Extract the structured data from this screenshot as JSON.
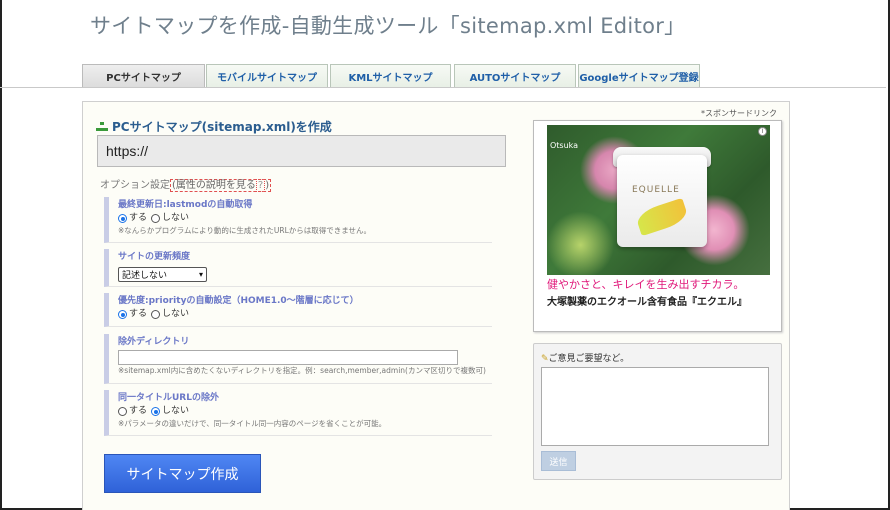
{
  "site_title": "サイトマップを作成-自動生成ツール「sitemap.xml Editor」",
  "tabs": [
    {
      "label": "PCサイトマップ"
    },
    {
      "label": "モバイルサイトマップ"
    },
    {
      "label": "KMLサイトマップ"
    },
    {
      "label": "AUTOサイトマップ"
    },
    {
      "label": "Googleサイトマップ登録"
    }
  ],
  "active_tab": "PCサイトマップ",
  "form": {
    "title": "PCサイトマップ(sitemap.xml)を作成",
    "url_value": "https://",
    "option_prefix": "オプション設定",
    "attr_link": "属性の説明を見る",
    "help_mark": "?"
  },
  "options": [
    {
      "title": "最終更新日:lastmodの自動取得",
      "radios": [
        {
          "label": "する",
          "checked": true
        },
        {
          "label": "しない",
          "checked": false
        }
      ],
      "note": "※なんらかプログラムにより動的に生成されたURLからは取得できません。"
    },
    {
      "title": "サイトの更新頻度",
      "select_value": "記述しない"
    },
    {
      "title": "優先度:priorityの自動設定（HOME1.0～階層に応じて）",
      "radios": [
        {
          "label": "する",
          "checked": true
        },
        {
          "label": "しない",
          "checked": false
        }
      ]
    },
    {
      "title": "除外ディレクトリ",
      "note": "※sitemap.xml内に含めたくないディレクトリを指定。例：search,member,admin(カンマ区切りで複数可)"
    },
    {
      "title": "同一タイトルURLの除外",
      "radios": [
        {
          "label": "する",
          "checked": false
        },
        {
          "label": "しない",
          "checked": true
        }
      ],
      "note": "※パラメータの違いだけで、同一タイトル同一内容のページを省くことが可能。"
    }
  ],
  "create_button": "サイトマップ作成",
  "sponsor_label": "*スポンサードリンク",
  "ad": {
    "brand": "Otsuka",
    "jar_label": "EQUELLE",
    "info": "i",
    "tagline": "健やかさと、キレイを生み出すチカラ。",
    "product": "大塚製薬のエクオール含有食品『エクエル』"
  },
  "comment": {
    "label": "ご意見ご要望など。",
    "send_button": "送信"
  },
  "icons": {
    "sitemap": "sitemap-tree-icon",
    "pencil": "pencil-icon",
    "select_arrow": "chevron-down-icon"
  },
  "colors": {
    "tab_text": "#1f5fa8",
    "title_text": "#2b5d8f",
    "option_title": "#6a77c7",
    "button_blue": "#2f62d8",
    "ad_pink": "#e0187a"
  }
}
